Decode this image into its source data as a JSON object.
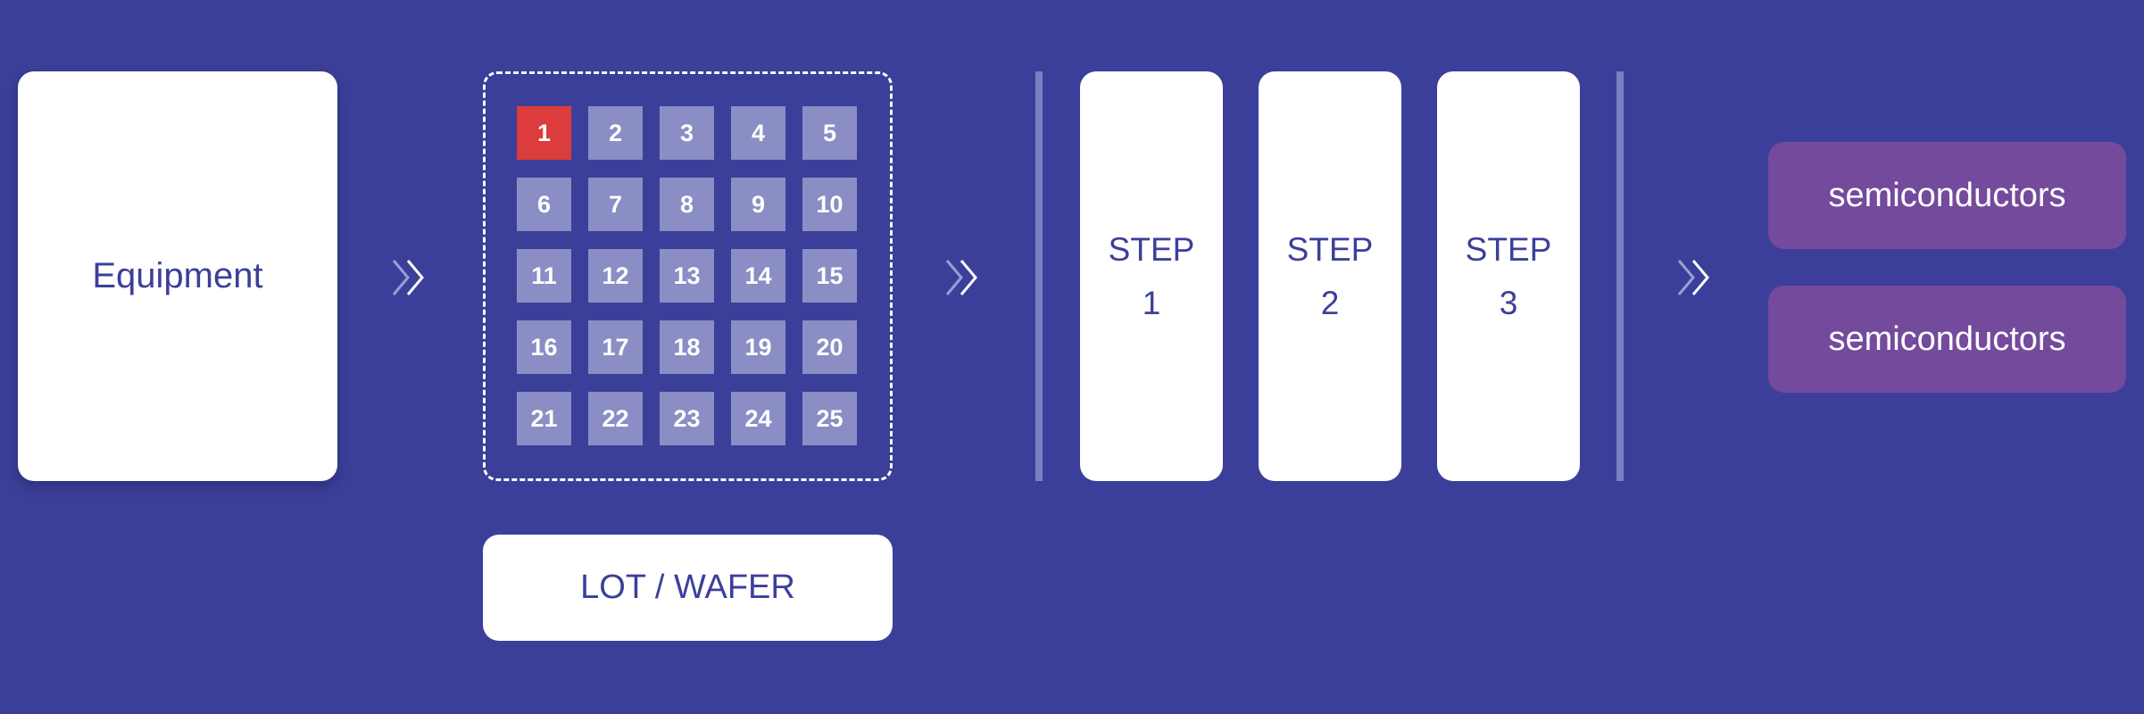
{
  "equipment": {
    "label": "Equipment"
  },
  "wafer_grid": {
    "cells": [
      "1",
      "2",
      "3",
      "4",
      "5",
      "6",
      "7",
      "8",
      "9",
      "10",
      "11",
      "12",
      "13",
      "14",
      "15",
      "16",
      "17",
      "18",
      "19",
      "20",
      "21",
      "22",
      "23",
      "24",
      "25"
    ],
    "active_cell": "1"
  },
  "lot_wafer": {
    "label": "LOT / WAFER"
  },
  "steps": [
    {
      "line1": "STEP",
      "line2": "1"
    },
    {
      "line1": "STEP",
      "line2": "2"
    },
    {
      "line1": "STEP",
      "line2": "3"
    }
  ],
  "outputs": [
    {
      "label": "semiconductors"
    },
    {
      "label": "semiconductors"
    }
  ],
  "icons": {
    "flow_arrow": "double-chevron-right-icon"
  },
  "colors": {
    "background": "#3c3f99",
    "tile": "#8a8ec4",
    "active_tile": "#dc3c3c",
    "output": "#744a9d",
    "divider": "#7a7fc0"
  }
}
